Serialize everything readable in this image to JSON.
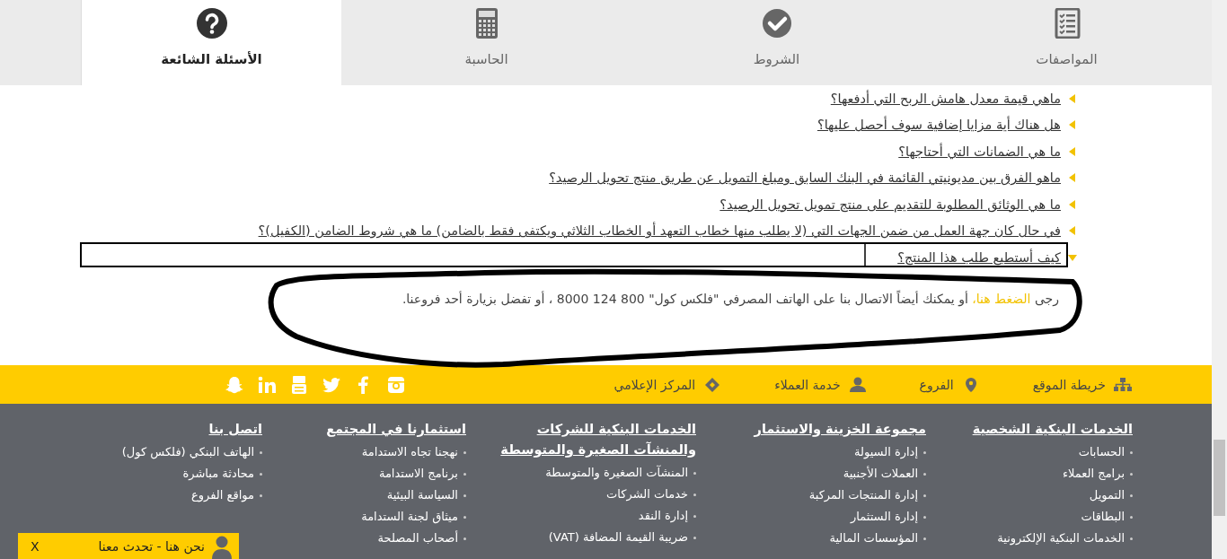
{
  "tabs": [
    {
      "label": "المواصفات",
      "kind": "checklist",
      "selected": false
    },
    {
      "label": "الشروط",
      "kind": "check",
      "selected": false
    },
    {
      "label": "الحاسبة",
      "kind": "calculator",
      "selected": false
    },
    {
      "label": "الأسئلة الشائعة",
      "kind": "question",
      "selected": true
    }
  ],
  "faq": [
    {
      "question": "ماهي قيمة معدل هامش الربح التي أدفعها؟",
      "expanded": false
    },
    {
      "question": "هل هناك أية مزايا إضافية سوف أحصل عليها؟",
      "expanded": false
    },
    {
      "question": "ما هي الضمانات التي أحتاجها؟",
      "expanded": false
    },
    {
      "question": "ماهو الفرق بين مديونيتي القائمة في البنك السابق ومبلغ التمويل عن طريق منتج تحويل الرصيد؟",
      "expanded": false
    },
    {
      "question": "ما هي الوثائق المطلوبة للتقديم على منتج تمويل تحويل الرصيد؟",
      "expanded": false
    },
    {
      "question": "في حال كان جهة العمل من ضمن الجهات التي (لا يطلب منها خطاب التعهد أو الخطاب الثلاثي ويكتفى فقط بالضامن) ما هي شروط الضامن (الكفيل)؟",
      "expanded": false
    },
    {
      "question": "كيف أستطيع طلب هذا المنتج؟",
      "expanded": true,
      "answer": {
        "before": "رجى",
        "link": "الضغط هنا،",
        "after": "أو يمكنك أيضاً الاتصال بنا على الهاتف المصرفي \"فلكس كول\" 800 124 8000 ، أو تفضل بزيارة أحد فروعنا."
      }
    }
  ],
  "quick_links": [
    {
      "label": "خريطة الموقع",
      "kind": "sitemap"
    },
    {
      "label": "الفروع",
      "kind": "pin"
    },
    {
      "label": "خدمة العملاء",
      "kind": "person"
    },
    {
      "label": "المركز الإعلامي",
      "kind": "diamond"
    }
  ],
  "social": [
    {
      "kind": "instagram"
    },
    {
      "kind": "facebook"
    },
    {
      "kind": "twitter"
    },
    {
      "kind": "youtube"
    },
    {
      "kind": "linkedin"
    },
    {
      "kind": "snapchat"
    }
  ],
  "footer_columns": [
    {
      "title": "الخدمات البنكية الشخصية",
      "items": [
        "الحسابات",
        "برامج العملاء",
        "التمويل",
        "البطاقات",
        "الخدمات البنكية الإلكترونية"
      ]
    },
    {
      "title": "مجموعة الخزينة والاستثمار",
      "items": [
        "إدارة السيولة",
        "العملات الأجنبية",
        "إدارة المنتجات المركبة",
        "إدارة الستثمار",
        "المؤسسات المالية"
      ]
    },
    {
      "title": "الخدمات البنكية للشركات والمنشآت الصغيرة والمتوسطة",
      "items": [
        "المنشآت الصغيرة والمتوسطة",
        "خدمات الشركات",
        "إدارة النقد",
        "ضريبة القيمة المضافة (VAT)"
      ]
    },
    {
      "title": "استثمارنا في المجتمع",
      "items": [
        "نهجنا تجاه الاستدامة",
        "برنامج الاستدامة",
        "السياسة البيئية",
        "ميثاق لجنة الستدامة",
        "أصحاب المصلحة"
      ]
    },
    {
      "title": "اتصل بنا",
      "items": [
        "الهاتف البنكي (فلكس كول)",
        "محادثة مباشرة",
        "مواقع الفروع"
      ]
    }
  ],
  "chat": {
    "label": "نحن هنا - تحدث معنا",
    "close": "X"
  }
}
